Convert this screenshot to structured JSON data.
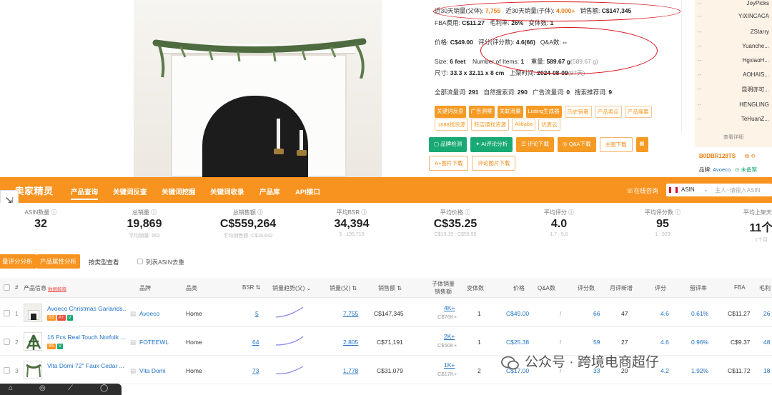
{
  "info": {
    "row1": {
      "a_label": "近30天销量(父体):",
      "a_val": "7,755",
      "b_label": "近30天销量(子体):",
      "b_val": "4,000+",
      "c_label": "销售额:",
      "c_val": "C$147,345"
    },
    "row2": {
      "a_label": "FBA费用:",
      "a_val": "C$11.27",
      "b_label": "毛利率:",
      "b_val": "26%",
      "c_label": "变体数:",
      "c_val": "1"
    },
    "row3": {
      "a_label": "价格:",
      "a_val": "C$49.00",
      "b_label": "评分(评分数):",
      "b_val": "4.6(66)",
      "c_label": "Q&A数:",
      "c_val": "--"
    },
    "row4": {
      "a_label": "Size:",
      "a_val": "6 feet",
      "b_label": "Number of Items:",
      "b_val": "1",
      "c_label": "重量:",
      "c_val": "589.67 g",
      "c_extra": "(589.67 g)"
    },
    "row5": {
      "a_label": "尺寸:",
      "a_val": "33.3 x 32.11 x 8 cm",
      "b_label": "上架时间:",
      "b_val": "2024-08-09",
      "b_extra": "(97天)"
    },
    "row6": {
      "a_label": "全部流量词:",
      "a_val": "291",
      "b_label": "自然搜索词:",
      "b_val": "290",
      "c_label": "广告流量词:",
      "c_val": "0",
      "d_label": "搜索推荐词:",
      "d_val": "9"
    },
    "tags1": [
      "关键词反查",
      "广告洞察",
      "关联流量",
      "Listing生成器",
      "历史销量",
      "产品卖点",
      "产品痛要"
    ],
    "tags2": [
      "1688找货源",
      "旺店通找货源",
      "Alibaba",
      "优麦云"
    ],
    "buttons1": [
      "品牌检测",
      "AI评论分析",
      "评论下载",
      "Q&A下载",
      "主图下载"
    ],
    "buttons2": [
      "A+图片下载",
      "评论图片下载"
    ]
  },
  "side": {
    "sellers": [
      "JoyPicks",
      "YIXINCACA",
      "ZStarry",
      "Yuanche...",
      "HgxiaoH...",
      "AOHAIS...",
      "昆明亦可...",
      "HENGLING",
      "TeHuanZ..."
    ],
    "dash": "--",
    "more": "查看详细",
    "asin": "B0DBR128TS",
    "brand_label": "品牌:",
    "brand": "Avoeco",
    "status": "未备案"
  },
  "nav": {
    "logo": "卖家精灵",
    "items": [
      "产品查询",
      "关键词反查",
      "关键词挖掘",
      "关键词收录",
      "产品库",
      "API接口"
    ],
    "online": "在线咨询",
    "asin_select": "ASIN",
    "search_placeholder": "主人~请输入ASIN"
  },
  "stats": [
    {
      "label": "ASIN数量",
      "value": "32",
      "sub": ""
    },
    {
      "label": "总销量",
      "value": "19,869",
      "sub": "平均销量: 662"
    },
    {
      "label": "总销售额",
      "value": "C$559,264",
      "sub": "平均销售额: C$18,642"
    },
    {
      "label": "平均BSR",
      "value": "34,394",
      "sub": "5 : 195,719"
    },
    {
      "label": "平均价格",
      "value": "C$35.25",
      "sub": "C$13.19 : C$59.99"
    },
    {
      "label": "平均评分",
      "value": "4.0",
      "sub": "1.7 : 5.0"
    },
    {
      "label": "平均评分数",
      "value": "95",
      "sub": "1 : 929"
    },
    {
      "label": "平均上架天",
      "value": "11个",
      "sub": "1个月"
    }
  ],
  "tools": {
    "btn1": "量评分分析",
    "btn2": "产品属性分析",
    "link": "按类型查看",
    "check": "列表ASIN去重"
  },
  "table": {
    "headers": [
      "#",
      "产品信息",
      "数据解释",
      "品牌",
      "品类",
      "BSR",
      "销量趋势(父)",
      "销量(父)",
      "销售额",
      "子体销量",
      "销售额",
      "变体数",
      "价格",
      "Q&A数",
      "评分数",
      "月评新增",
      "评分",
      "留评率",
      "FBA",
      "毛利"
    ],
    "rows": [
      {
        "idx": "1",
        "title": "Avoeco Christmas Garlands...",
        "brand": "Avoeco",
        "cat": "Home",
        "bsr": "5",
        "sales": "7,755",
        "revenue": "C$147,345",
        "child_sales": "4K+",
        "child_rev": "C$76K+",
        "variants": "1",
        "price": "C$49.00",
        "qa": "/",
        "reviews": "66",
        "monthly": "47",
        "rating": "4.6",
        "rate": "0.61%",
        "fba": "C$11.27",
        "margin": "26"
      },
      {
        "idx": "2",
        "title": "16 Pcs Real Touch Norfolk ...",
        "brand": "FOTEEWL",
        "cat": "Home",
        "bsr": "64",
        "sales": "2,805",
        "revenue": "C$71,191",
        "child_sales": "2K+",
        "child_rev": "C$50K+",
        "variants": "1",
        "price": "C$25.38",
        "qa": "/",
        "reviews": "59",
        "monthly": "27",
        "rating": "4.6",
        "rate": "0.96%",
        "fba": "C$9.37",
        "margin": "48"
      },
      {
        "idx": "3",
        "title": "Vita Domi 72\" Faux Cedar ...",
        "brand": "Vita Domi",
        "cat": "Home",
        "bsr": "73",
        "sales": "1,778",
        "revenue": "C$31,079",
        "child_sales": "1K+",
        "child_rev": "C$17K+",
        "variants": "2",
        "price": "C$17.00",
        "qa": "/",
        "reviews": "33",
        "monthly": "20",
        "rating": "4.2",
        "rate": "1.92%",
        "fba": "C$11.72",
        "margin": "18"
      }
    ]
  },
  "watermark": "公众号 · 跨境电商超仔"
}
